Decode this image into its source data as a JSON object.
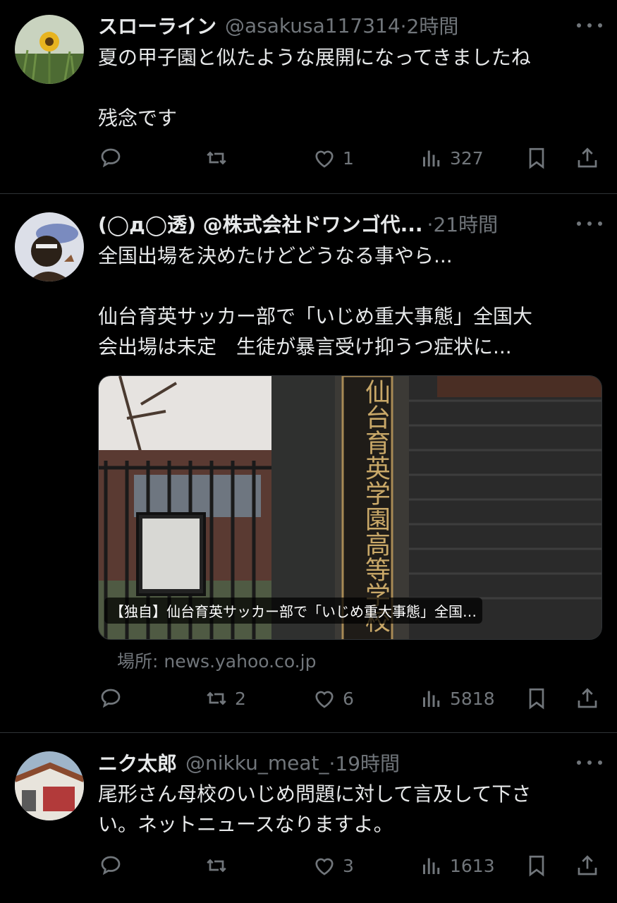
{
  "tweets": [
    {
      "name": "スローライン",
      "handle": "@asakusa117314",
      "time": "·2時間",
      "lines": [
        "夏の甲子園と似たような展開になってきましたね",
        "",
        "残念です"
      ],
      "replies": "",
      "retweets": "",
      "likes": "1",
      "views": "327"
    },
    {
      "name": "(◯д◯透) @株式会社ドワンゴ代...",
      "handle": "",
      "time": "·21時間",
      "lines": [
        "全国出場を決めたけどどうなる事やら...",
        "",
        "仙台育英サッカー部で「いじめ重大事態」全国大",
        "会出場は未定　生徒が暴言受け抑うつ症状に..."
      ],
      "card": {
        "caption": "【独自】仙台育英サッカー部で「いじめ重大事態」全国…",
        "sign_text": "仙台育英学園高等学校",
        "source": "場所: news.yahoo.co.jp"
      },
      "replies": "",
      "retweets": "2",
      "likes": "6",
      "views": "5818"
    },
    {
      "name": "ニク太郎",
      "handle": "@nikku_meat_",
      "time": "·19時間",
      "lines": [
        "尾形さん母校のいじめ問題に対して言及して下さ",
        "い。ネットニュースなりますよ。"
      ],
      "replies": "",
      "retweets": "",
      "likes": "3",
      "views": "1613"
    }
  ],
  "icons": [
    "reply-icon",
    "retweet-icon",
    "like-icon",
    "views-icon",
    "bookmark-icon",
    "share-icon",
    "more-icon"
  ],
  "colors": {
    "background": "#000000",
    "text": "#e7e9ea",
    "secondary": "#71767b",
    "divider": "#2f3336"
  }
}
